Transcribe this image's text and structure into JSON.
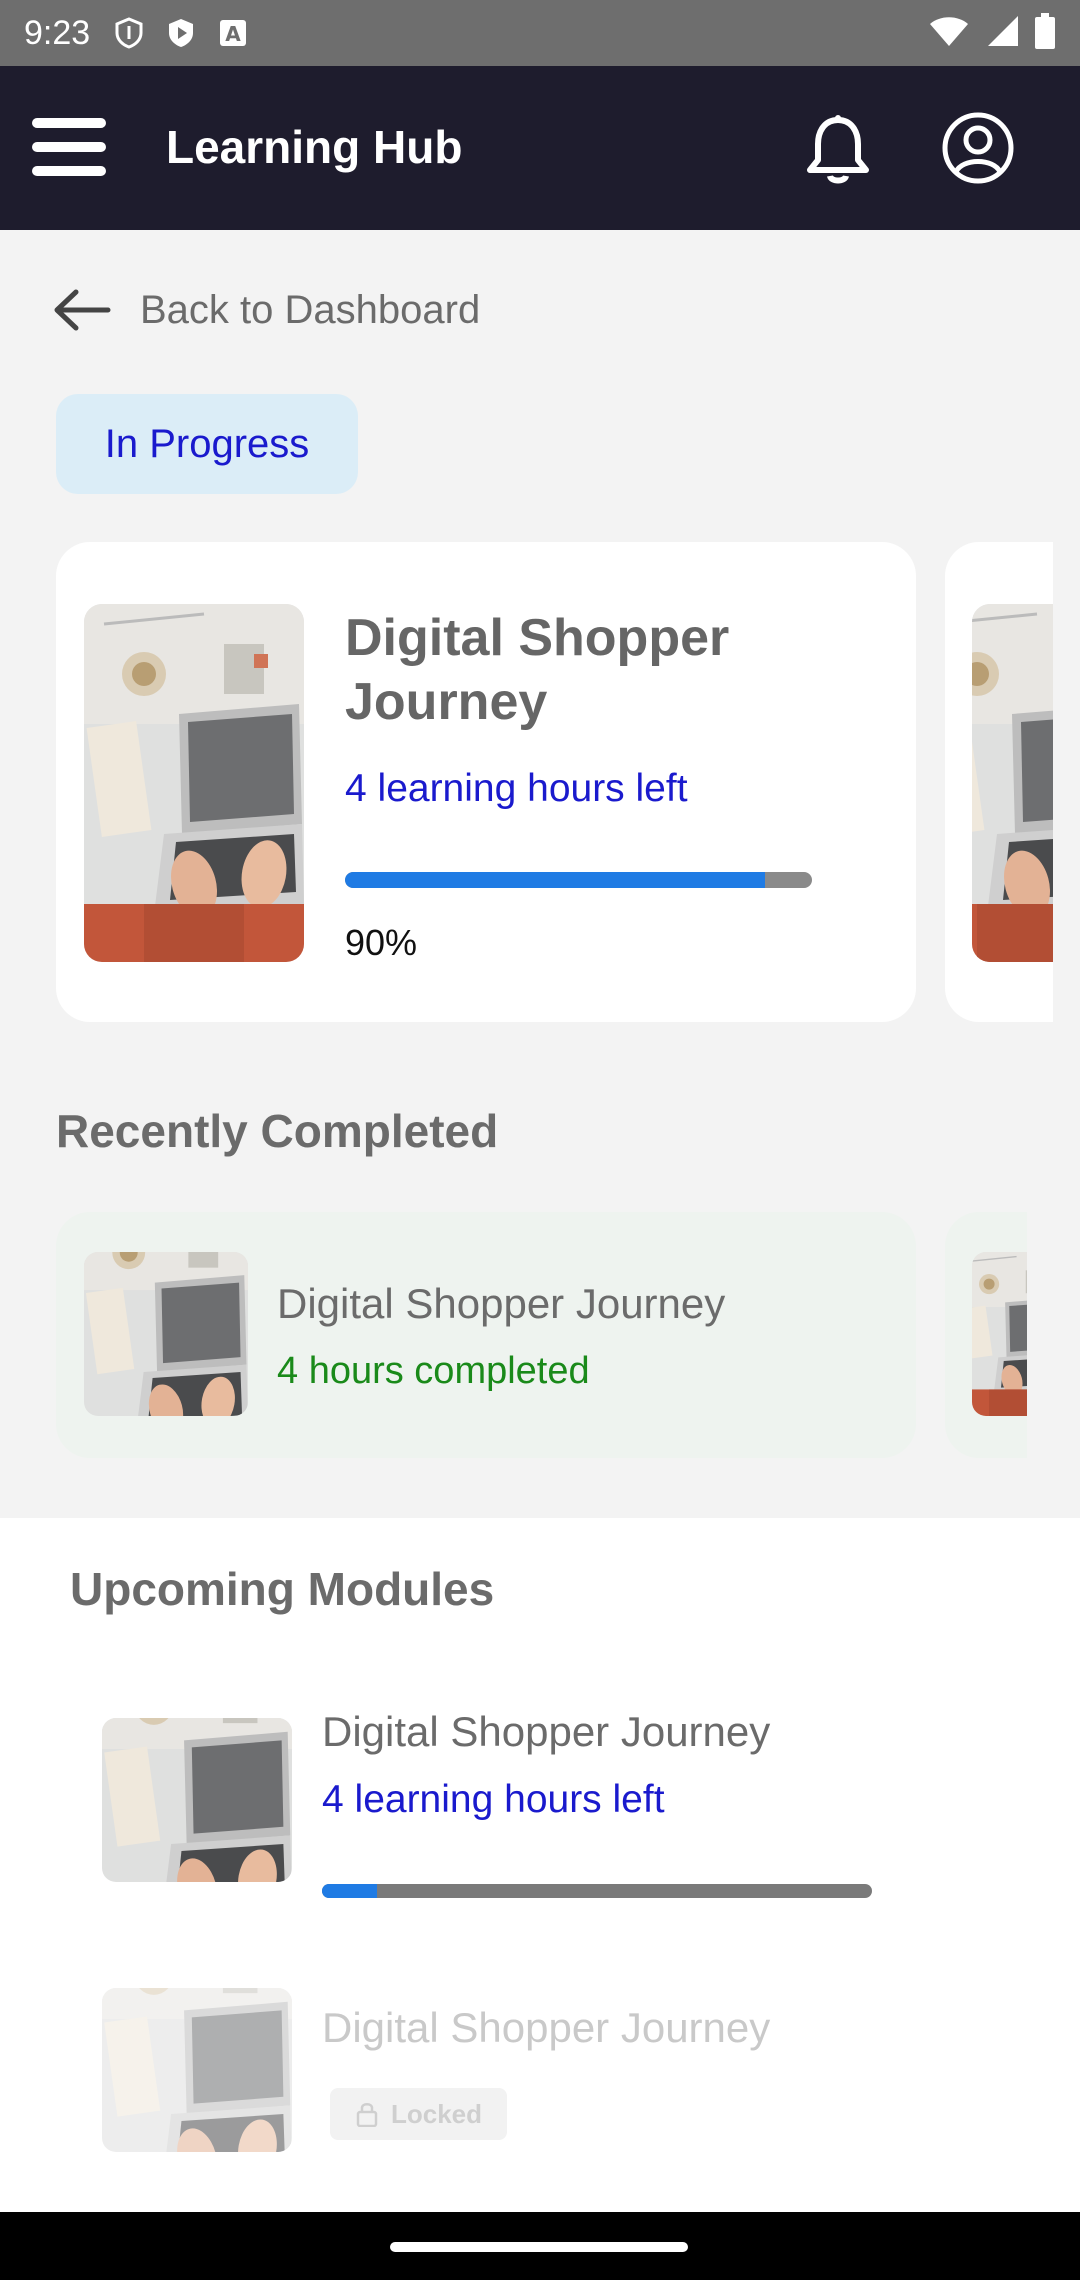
{
  "status_bar": {
    "time": "9:23"
  },
  "app_bar": {
    "title": "Learning Hub"
  },
  "back_link": {
    "label": "Back to Dashboard"
  },
  "filter_chip": {
    "label": "In Progress"
  },
  "in_progress": {
    "title": "Digital Shopper Journey",
    "hours_left": "4 learning hours left",
    "progress": 0.9,
    "percent_label": "90%"
  },
  "recently_completed": {
    "section_title": "Recently Completed",
    "card": {
      "title": "Digital Shopper Journey",
      "subtitle": "4 hours completed"
    }
  },
  "upcoming": {
    "section_title": "Upcoming Modules",
    "modules": [
      {
        "title": "Digital Shopper Journey",
        "hours_left": "4 learning hours left",
        "progress": 0.1
      },
      {
        "title": "Digital Shopper Journey",
        "locked_label": "Locked"
      }
    ]
  },
  "colors": {
    "app_bar": "#1e1c2d",
    "accent_blue": "#1f7be4",
    "link_blue": "#1a1acd",
    "completed_green": "#1a8a1a",
    "chip_bg": "#dbedf7"
  },
  "icons": [
    "menu-icon",
    "bell-icon",
    "profile-icon",
    "back-arrow-icon",
    "lock-icon"
  ]
}
